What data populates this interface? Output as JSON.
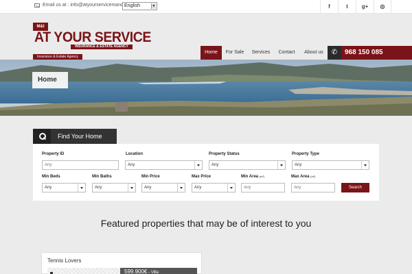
{
  "topbar": {
    "email_text": "Email us at : info@atyourservicemandi.com",
    "language": "English",
    "social": [
      {
        "icon": "facebook-icon",
        "glyph": "f"
      },
      {
        "icon": "twitter-icon",
        "glyph": "t"
      },
      {
        "icon": "google-plus-icon",
        "glyph": "g+"
      },
      {
        "icon": "instagram-icon",
        "glyph": "◎"
      }
    ]
  },
  "logo": {
    "badge": "M&I",
    "title": "AT YOUR SERVICE",
    "subtitle": "INSURANCE & ESTATE AGENCY",
    "tagline": "Insurance & Estate Agency"
  },
  "nav": {
    "items": [
      "Home",
      "For Sale",
      "Services",
      "Contact",
      "About us"
    ],
    "active": "Home"
  },
  "phone": {
    "number": "968 150 085",
    "icon": "phone-icon"
  },
  "banner": {
    "label": "Home"
  },
  "search": {
    "tab_label": "Find Your Home",
    "fields": {
      "property_id": {
        "label": "Property ID",
        "placeholder": "Any"
      },
      "location": {
        "label": "Location",
        "value": "Any"
      },
      "status": {
        "label": "Property Status",
        "value": "Any"
      },
      "type": {
        "label": "Property Type",
        "value": "Any"
      },
      "min_beds": {
        "label": "Min Beds",
        "value": "Any"
      },
      "min_baths": {
        "label": "Min Baths",
        "value": "Any"
      },
      "min_price": {
        "label": "Min Price",
        "value": "Any"
      },
      "max_price": {
        "label": "Max Price",
        "value": "Any"
      },
      "min_area": {
        "label": "Min Area",
        "unit": "(m²)",
        "placeholder": "Any"
      },
      "max_area": {
        "label": "Max Area",
        "unit": "(m²)",
        "placeholder": "Any"
      }
    },
    "button": "Search"
  },
  "featured_heading": "Featured properties that may be of interest to you",
  "card": {
    "title": "Tennis Lovers",
    "price": "599.900€",
    "type": " - Villa"
  },
  "colors": {
    "brand": "#7a1418",
    "dark": "#333333"
  }
}
